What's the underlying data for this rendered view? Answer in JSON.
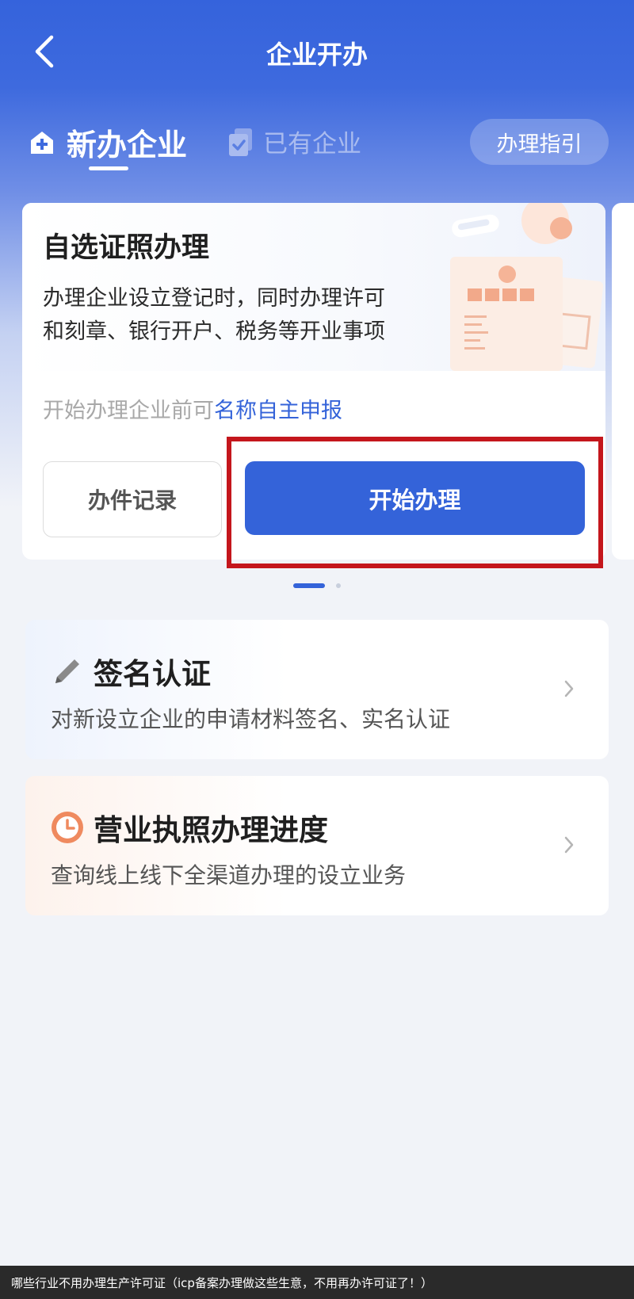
{
  "header": {
    "title": "企业开办"
  },
  "tabs": {
    "new_label": "新办企业",
    "existing_label": "已有企业",
    "guide_label": "办理指引"
  },
  "card": {
    "title": "自选证照办理",
    "desc_line1": "办理企业设立登记时，同时办理许可",
    "desc_line2": "和刻章、银行开户、税务等开业事项",
    "name_prefix": "开始办理企业前可",
    "name_link": "名称自主申报",
    "records_button": "办件记录",
    "start_button": "开始办理"
  },
  "carousel": {
    "active_index": 0,
    "count": 2
  },
  "services": [
    {
      "title": "签名认证",
      "desc": "对新设立企业的申请材料签名、实名认证",
      "icon": "pencil-icon"
    },
    {
      "title": "营业执照办理进度",
      "desc": "查询线上线下全渠道办理的设立业务",
      "icon": "clock-icon"
    }
  ],
  "caption": "哪些行业不用办理生产许可证（icp备案办理做这些生意，不用再办许可证了！）",
  "colors": {
    "primary": "#3463d9",
    "header_blue": "#3563dc",
    "highlight_red": "#c4161c",
    "progress_orange": "#ef8a5f"
  }
}
